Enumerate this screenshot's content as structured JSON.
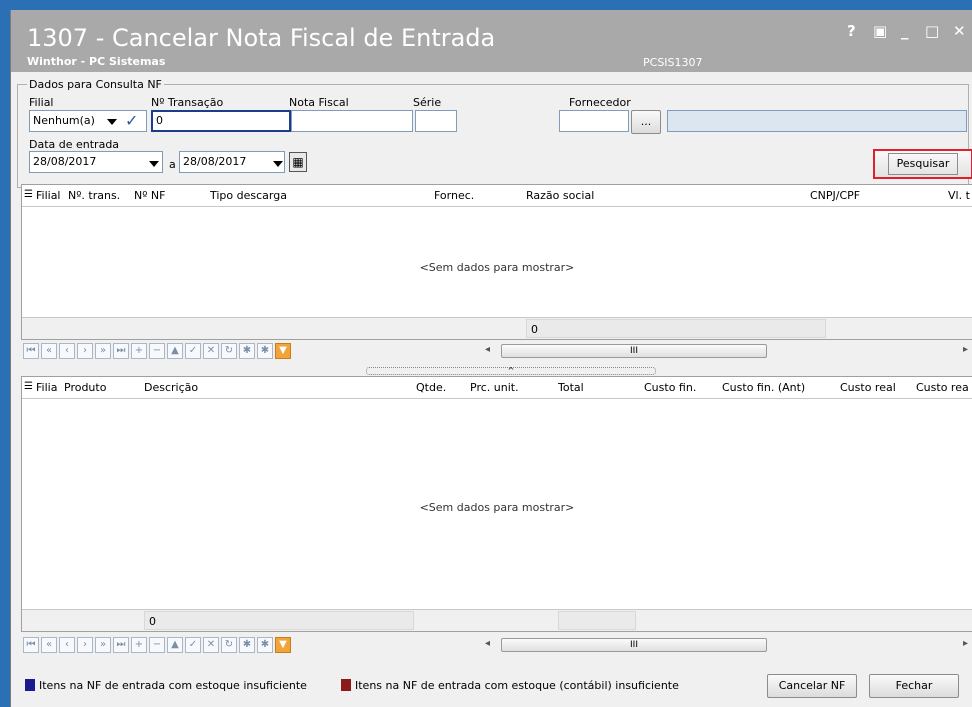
{
  "window": {
    "title": "1307 - Cancelar Nota Fiscal de  Entrada",
    "subtitle": "Winthor - PC Sistemas",
    "code": "PCSIS1307",
    "controls": {
      "help": "?",
      "restore": "▣",
      "minimize": "_",
      "maximize": "□",
      "close": "✕"
    }
  },
  "filters": {
    "group_title": "Dados para Consulta NF",
    "filial_label": "Filial",
    "filial_value": "Nenhum(a)",
    "transacao_label": "Nº Transação",
    "transacao_value": "0",
    "nota_label": "Nota Fiscal",
    "nota_value": "",
    "serie_label": "Série",
    "serie_value": "",
    "fornecedor_label": "Fornecedor",
    "fornecedor_value": "",
    "fornecedor_name": "",
    "browse_label": "...",
    "data_label": "Data de entrada",
    "date_from": "28/08/2017",
    "date_sep": "a",
    "date_to": "28/08/2017",
    "search_label": "Pesquisar"
  },
  "grid1": {
    "columns": [
      "Filial",
      "Nº. trans.",
      "Nº NF",
      "Tipo descarga",
      "Fornec.",
      "Razão social",
      "CNPJ/CPF",
      "Vl. t"
    ],
    "empty": "<Sem dados para mostrar>",
    "footer_total": "0"
  },
  "grid2": {
    "columns": [
      "Filia",
      "Produto",
      "Descrição",
      "Qtde.",
      "Prc. unit.",
      "Total",
      "Custo fin.",
      "Custo fin. (Ant)",
      "Custo real",
      "Custo rea"
    ],
    "empty": "<Sem dados para mostrar>",
    "footer_total": "0"
  },
  "nav": {
    "buttons": [
      "⏮",
      "«",
      "‹",
      "›",
      "»",
      "⏭",
      "+",
      "−",
      "▲",
      "✓",
      "✕",
      "↻",
      "✱",
      "✱",
      "▼"
    ],
    "scroll_thumb": "III",
    "scroll_left": "◂",
    "scroll_right": "▸",
    "splitter_arrow": "^"
  },
  "legend": {
    "item1": "Itens na NF de entrada com estoque insuficiente",
    "item1_color": "#1a1a8c",
    "item2": "Itens na NF de entrada com estoque (contábil) insuficiente",
    "item2_color": "#8b1a1a"
  },
  "actions": {
    "cancel_nf": "Cancelar NF",
    "close": "Fechar"
  }
}
